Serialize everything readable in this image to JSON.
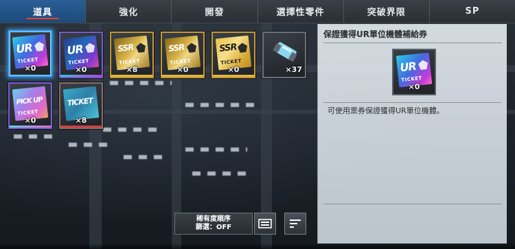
{
  "tabs": [
    {
      "label": "道具",
      "active": true
    },
    {
      "label": "強化",
      "active": false
    },
    {
      "label": "開發",
      "active": false
    },
    {
      "label": "選擇性零件",
      "active": false
    },
    {
      "label": "突破界限",
      "active": false
    },
    {
      "label": "SP",
      "active": false
    }
  ],
  "items": [
    {
      "main": "UR",
      "sub": "TICKET",
      "qty": "×0",
      "theme": "ur"
    },
    {
      "main": "UR",
      "sub": "TICKET",
      "qty": "×0",
      "theme": "ur2"
    },
    {
      "main": "SSR",
      "sub": "TICKET",
      "qty": "×8",
      "theme": "ssr"
    },
    {
      "main": "SSR",
      "sub": "TICKET",
      "qty": "×0",
      "theme": "ssr"
    },
    {
      "main": "SSR",
      "sub": "TICKET",
      "qty": "×0",
      "theme": "ssr"
    },
    {
      "main": "",
      "sub": "",
      "qty": "×37",
      "theme": "capsule"
    },
    {
      "main": "PICK UP",
      "sub": "TICKET",
      "qty": "×0",
      "theme": "pickup"
    },
    {
      "main": "TICKET",
      "sub": "",
      "qty": "×8",
      "theme": "ticket"
    }
  ],
  "detail": {
    "title": "保證獲得UR單位機體補給券",
    "item_main": "UR",
    "item_sub": "TICKET",
    "qty": "×0",
    "description": "可使用票券保證獲得UR單位機體。"
  },
  "sort": {
    "line1": "稀有度順序",
    "line2": "篩選：OFF"
  },
  "colors": {
    "tab_active": "#1c4a7a",
    "selected_border": "#3ba7ff",
    "underline": "#e8412c"
  },
  "icons": {
    "view_toggle": "list-view-icon",
    "sort": "sort-lines-icon"
  }
}
